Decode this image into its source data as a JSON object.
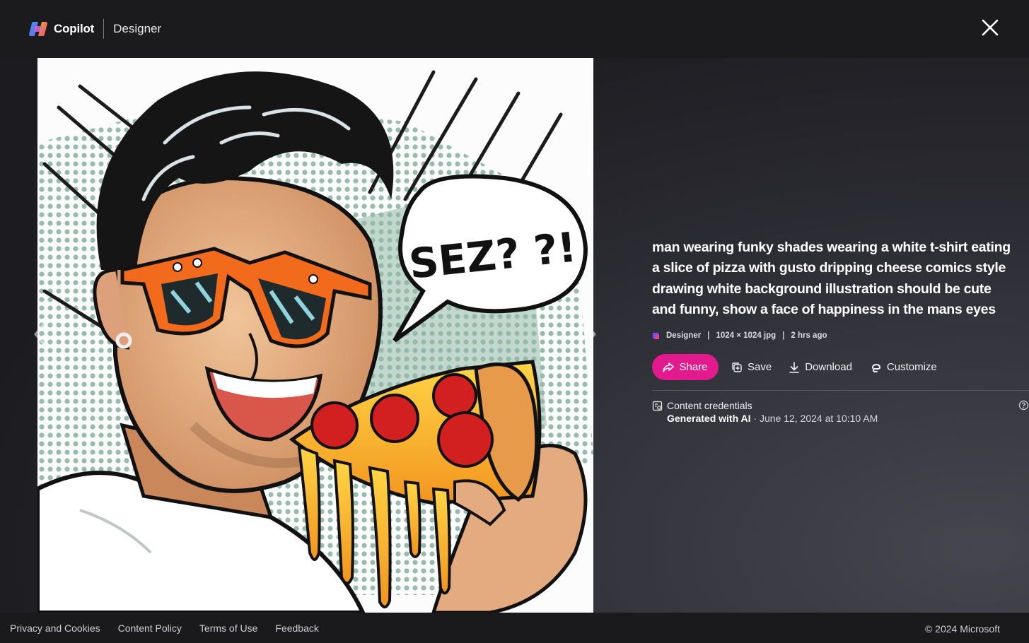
{
  "header": {
    "brand": "Copilot",
    "section": "Designer",
    "close_icon": "close-icon"
  },
  "image": {
    "speech_text": "SEZ? ?!",
    "nav_prev_icon": "chevron-left-icon",
    "nav_next_icon": "chevron-right-icon"
  },
  "details": {
    "prompt": "man wearing funky shades wearing a white t-shirt eating a slice of pizza with gusto dripping cheese comics style drawing white background illustration should be cute and funny, show a face of happiness in the mans eyes",
    "meta": {
      "source": "Designer",
      "dimensions": "1024 × 1024 jpg",
      "age": "2 hrs ago",
      "separator": "|"
    },
    "actions": {
      "share": "Share",
      "save": "Save",
      "download": "Download",
      "customize": "Customize"
    },
    "credentials": {
      "title": "Content credentials",
      "generated": "Generated with AI",
      "date": " · June 12, 2024 at 10:10 AM"
    }
  },
  "footer": {
    "links": [
      "Privacy and Cookies",
      "Content Policy",
      "Terms of Use",
      "Feedback"
    ],
    "copyright": "© 2024 Microsoft"
  },
  "colors": {
    "accent": "#e3198e",
    "background": "#1c1b1f",
    "topbar": "#1b1a1d"
  }
}
